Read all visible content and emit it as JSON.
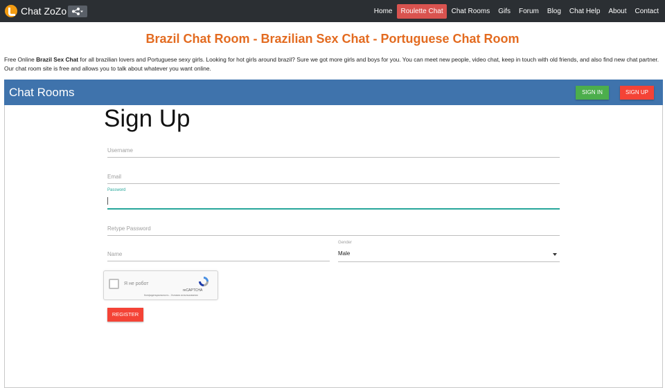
{
  "navbar": {
    "brand": "Chat ZoZo",
    "items": [
      {
        "label": "Home",
        "active": false
      },
      {
        "label": "Roulette Chat",
        "active": true
      },
      {
        "label": "Chat Rooms",
        "active": false
      },
      {
        "label": "Gifs",
        "active": false
      },
      {
        "label": "Forum",
        "active": false
      },
      {
        "label": "Blog",
        "active": false
      },
      {
        "label": "Chat Help",
        "active": false
      },
      {
        "label": "About",
        "active": false
      },
      {
        "label": "Contact",
        "active": false
      }
    ],
    "active_color": "#d9534f",
    "background": "#2b2f33"
  },
  "page": {
    "title": "Brazil Chat Room - Brazilian Sex Chat - Portuguese Chat Room",
    "title_color": "#e36b20",
    "intro_prefix": "Free Online ",
    "intro_bold": "Brazil Sex Chat",
    "intro_rest": " for all brazilian lovers and Portuguese sexy girls. Looking for hot girls around brazil? Sure we got more girls and boys for you. You can meet new people, video chat, keep in touch with old friends, and also find new chat partner. Our chat room site is free and allows you to talk about whatever you want online."
  },
  "panel": {
    "title": "Chat Rooms",
    "header_color": "#3f73ac",
    "sign_in_label": "SIGN IN",
    "sign_up_label": "SIGN UP"
  },
  "form": {
    "title": "Sign Up",
    "username_placeholder": "Username",
    "email_placeholder": "Email",
    "password_label": "Password",
    "password_value": "",
    "retype_password_placeholder": "Retype Password",
    "name_placeholder": "Name",
    "gender_label": "Gender",
    "gender_value": "Male",
    "register_label": "REGISTER",
    "focus_color": "#26a69a"
  },
  "recaptcha": {
    "checkbox_text": "Я не робот",
    "brand": "reCAPTCHA",
    "terms": "Конфиденциальность - Условия использования"
  }
}
